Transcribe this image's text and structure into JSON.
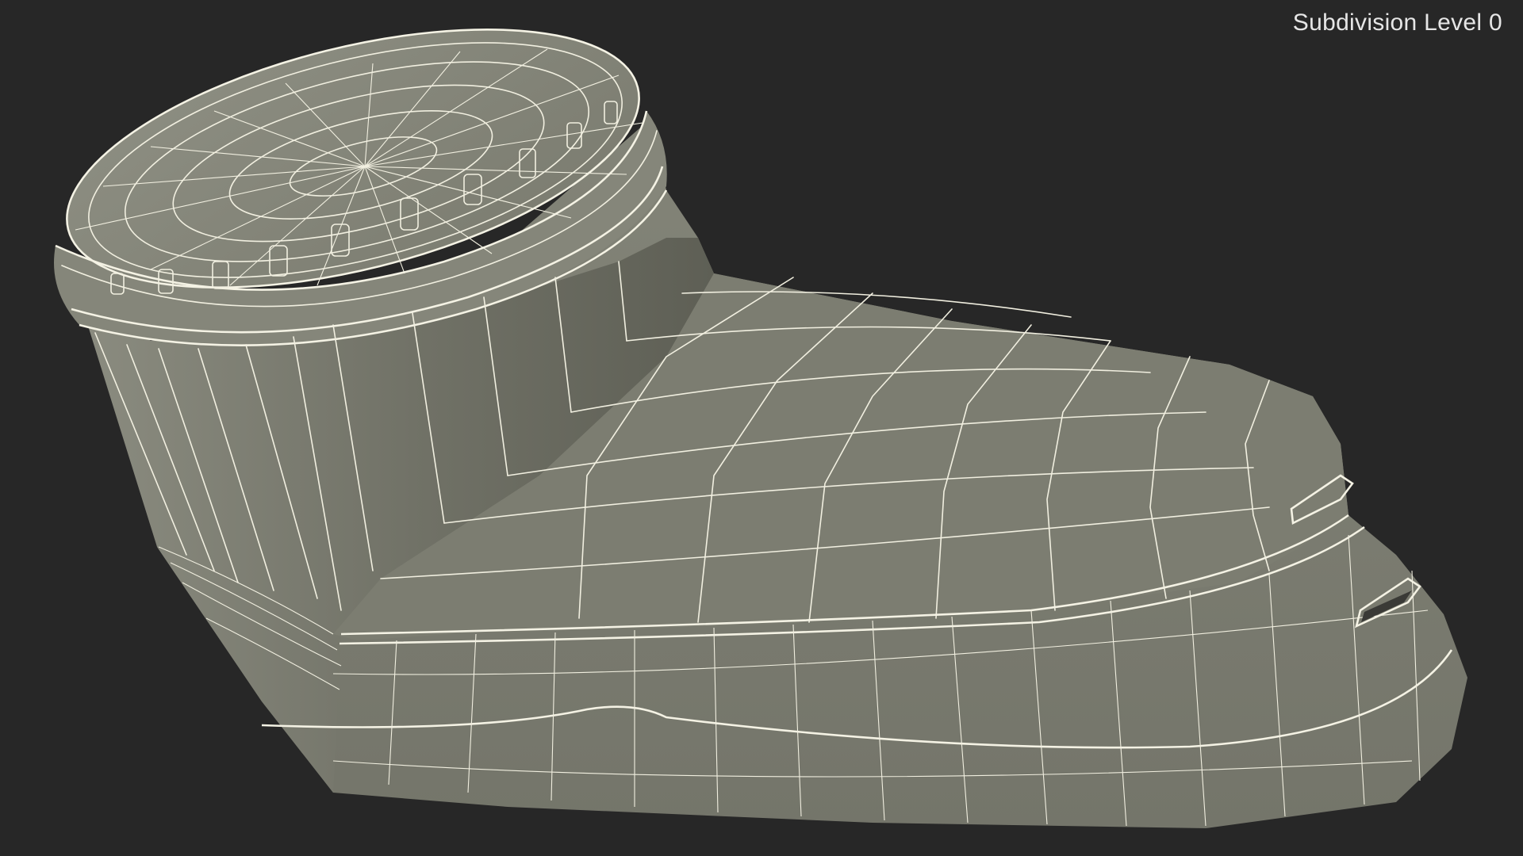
{
  "viewport": {
    "overlay_label": "Subdivision Level 0",
    "background_color": "#272727"
  },
  "model": {
    "surface_color": "#7b7c6f",
    "wire_color": "#f1efe0"
  }
}
